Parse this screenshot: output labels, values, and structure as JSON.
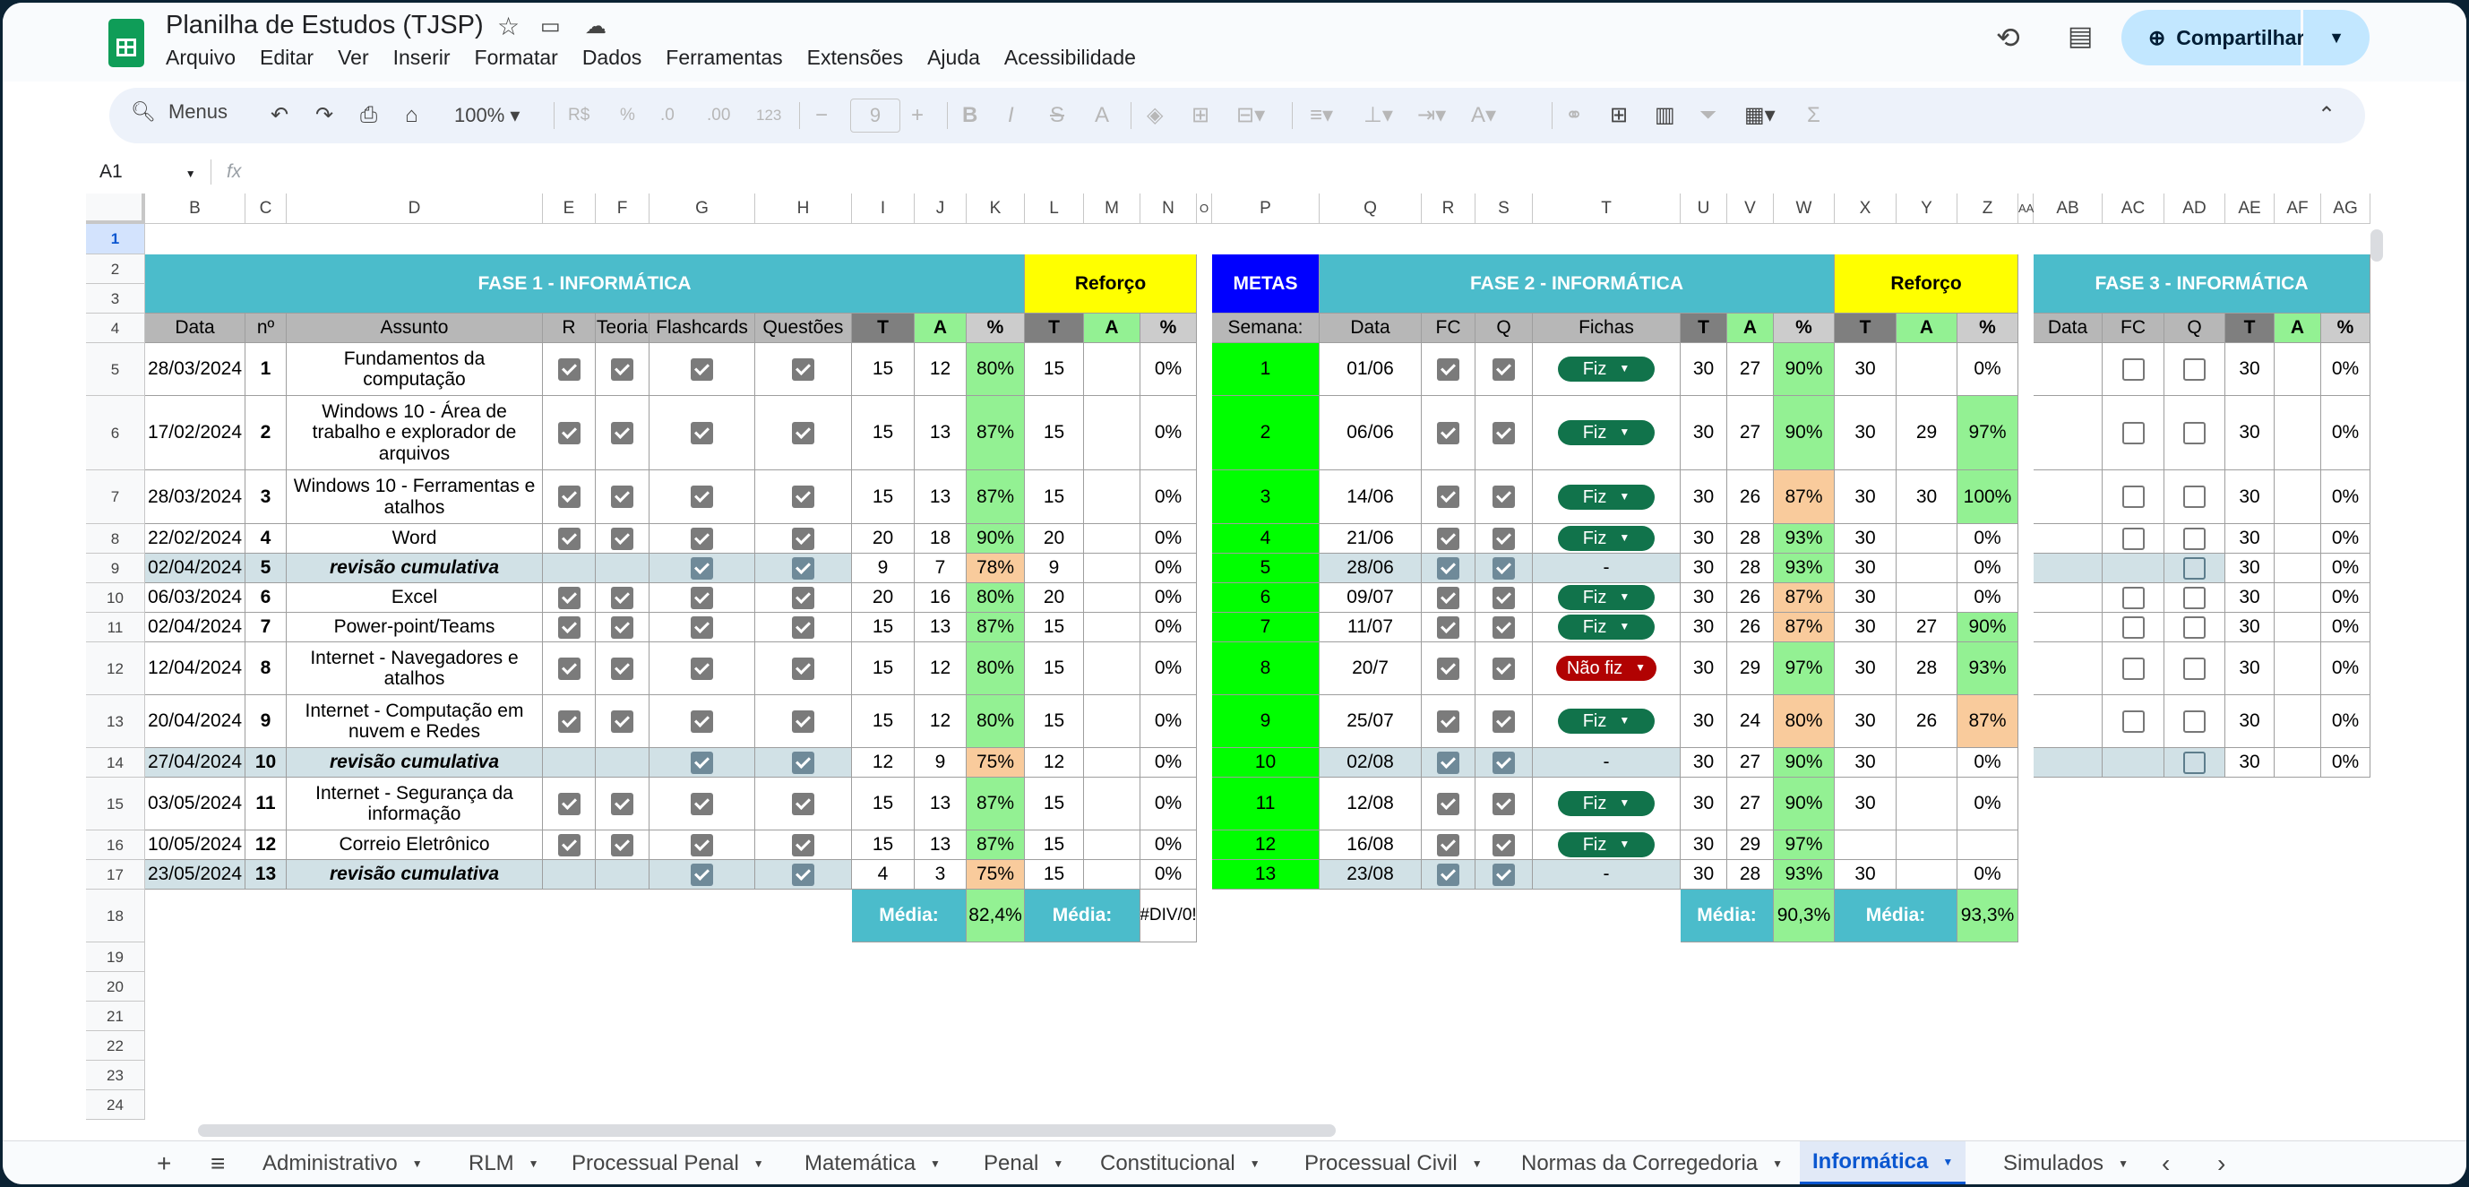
{
  "app": {
    "title": "Planilha de Estudos (TJSP)",
    "share_label": "Compartilhar",
    "menu": [
      "Arquivo",
      "Editar",
      "Ver",
      "Inserir",
      "Formatar",
      "Dados",
      "Ferramentas",
      "Extensões",
      "Ajuda",
      "Acessibilidade"
    ]
  },
  "toolbar": {
    "search": "Menus",
    "zoom": "100%",
    "font_size": "9",
    "currency": "R$",
    "percent": "%",
    "dec_down": ".0",
    "dec_up": ".00",
    "num": "123"
  },
  "formula": {
    "cell": "A1",
    "fx": "fx"
  },
  "columns": [
    "B",
    "C",
    "D",
    "E",
    "F",
    "G",
    "H",
    "I",
    "J",
    "K",
    "L",
    "M",
    "N",
    "O",
    "P",
    "Q",
    "R",
    "S",
    "T",
    "U",
    "V",
    "W",
    "X",
    "Y",
    "Z",
    "AA",
    "AB",
    "AC",
    "AD",
    "AE",
    "AF",
    "AG"
  ],
  "rows": [
    "1",
    "2",
    "3",
    "4",
    "5",
    "6",
    "7",
    "8",
    "9",
    "10",
    "11",
    "12",
    "13",
    "14",
    "15",
    "16",
    "17",
    "18",
    "19",
    "20",
    "21",
    "22",
    "23",
    "24"
  ],
  "headers": {
    "fase1": "FASE 1 - INFORMÁTICA",
    "fase2": "FASE 2 - INFORMÁTICA",
    "fase3": "FASE 3 - INFORMÁTICA",
    "reforco": "Reforço",
    "metas": "METAS"
  },
  "subheaders": {
    "data": "Data",
    "n": "nº",
    "assunto": "Assunto",
    "r": "R",
    "teoria": "Teoria",
    "flashcards": "Flashcards",
    "questoes": "Questões",
    "t": "T",
    "a": "A",
    "pct": "%",
    "semana": "Semana:",
    "fc": "FC",
    "q": "Q",
    "fichas": "Fichas"
  },
  "fase1": [
    {
      "data": "28/03/2024",
      "n": "1",
      "assunto": "Fundamentos da computação",
      "rev": false,
      "t": "15",
      "a": "12",
      "p": "80%",
      "pc": "lgreen",
      "rt": "15",
      "ra": "",
      "rp": "0%"
    },
    {
      "data": "17/02/2024",
      "n": "2",
      "assunto": "Windows 10 - Área de trabalho e explorador de arquivos",
      "rev": false,
      "t": "15",
      "a": "13",
      "p": "87%",
      "pc": "lgreen",
      "rt": "15",
      "ra": "",
      "rp": "0%"
    },
    {
      "data": "28/03/2024",
      "n": "3",
      "assunto": "Windows 10 - Ferramentas e atalhos",
      "rev": false,
      "t": "15",
      "a": "13",
      "p": "87%",
      "pc": "lgreen",
      "rt": "15",
      "ra": "",
      "rp": "0%"
    },
    {
      "data": "22/02/2024",
      "n": "4",
      "assunto": "Word",
      "rev": false,
      "t": "20",
      "a": "18",
      "p": "90%",
      "pc": "lgreen",
      "rt": "20",
      "ra": "",
      "rp": "0%"
    },
    {
      "data": "02/04/2024",
      "n": "5",
      "assunto": "revisão cumulativa",
      "rev": true,
      "t": "9",
      "a": "7",
      "p": "78%",
      "pc": "orange",
      "rt": "9",
      "ra": "",
      "rp": "0%"
    },
    {
      "data": "06/03/2024",
      "n": "6",
      "assunto": "Excel",
      "rev": false,
      "t": "20",
      "a": "16",
      "p": "80%",
      "pc": "lgreen",
      "rt": "20",
      "ra": "",
      "rp": "0%"
    },
    {
      "data": "02/04/2024",
      "n": "7",
      "assunto": "Power-point/Teams",
      "rev": false,
      "t": "15",
      "a": "13",
      "p": "87%",
      "pc": "lgreen",
      "rt": "15",
      "ra": "",
      "rp": "0%"
    },
    {
      "data": "12/04/2024",
      "n": "8",
      "assunto": "Internet - Navegadores e atalhos",
      "rev": false,
      "t": "15",
      "a": "12",
      "p": "80%",
      "pc": "lgreen",
      "rt": "15",
      "ra": "",
      "rp": "0%"
    },
    {
      "data": "20/04/2024",
      "n": "9",
      "assunto": "Internet - Computação em nuvem e Redes",
      "rev": false,
      "t": "15",
      "a": "12",
      "p": "80%",
      "pc": "lgreen",
      "rt": "15",
      "ra": "",
      "rp": "0%"
    },
    {
      "data": "27/04/2024",
      "n": "10",
      "assunto": "revisão cumulativa",
      "rev": true,
      "t": "12",
      "a": "9",
      "p": "75%",
      "pc": "orange",
      "rt": "12",
      "ra": "",
      "rp": "0%"
    },
    {
      "data": "03/05/2024",
      "n": "11",
      "assunto": "Internet - Segurança da informação",
      "rev": false,
      "t": "15",
      "a": "13",
      "p": "87%",
      "pc": "lgreen",
      "rt": "15",
      "ra": "",
      "rp": "0%"
    },
    {
      "data": "10/05/2024",
      "n": "12",
      "assunto": "Correio Eletrônico",
      "rev": false,
      "t": "15",
      "a": "13",
      "p": "87%",
      "pc": "lgreen",
      "rt": "15",
      "ra": "",
      "rp": "0%"
    },
    {
      "data": "23/05/2024",
      "n": "13",
      "assunto": "revisão cumulativa",
      "rev": true,
      "t": "4",
      "a": "3",
      "p": "75%",
      "pc": "orange",
      "rt": "15",
      "ra": "",
      "rp": "0%"
    }
  ],
  "fase2": [
    {
      "semana": "1",
      "data": "01/06",
      "ficha": "Fiz",
      "t": "30",
      "a": "27",
      "p": "90%",
      "pc": "lgreen",
      "rt": "30",
      "ra": "",
      "rp": "0%",
      "rpc": ""
    },
    {
      "semana": "2",
      "data": "06/06",
      "ficha": "Fiz",
      "t": "30",
      "a": "27",
      "p": "90%",
      "pc": "lgreen",
      "rt": "30",
      "ra": "29",
      "rp": "97%",
      "rpc": "lgreen"
    },
    {
      "semana": "3",
      "data": "14/06",
      "ficha": "Fiz",
      "t": "30",
      "a": "26",
      "p": "87%",
      "pc": "orange",
      "rt": "30",
      "ra": "30",
      "rp": "100%",
      "rpc": "lgreen"
    },
    {
      "semana": "4",
      "data": "21/06",
      "ficha": "Fiz",
      "t": "30",
      "a": "28",
      "p": "93%",
      "pc": "lgreen",
      "rt": "30",
      "ra": "",
      "rp": "0%",
      "rpc": ""
    },
    {
      "semana": "5",
      "data": "28/06",
      "ficha": "-",
      "t": "30",
      "a": "28",
      "p": "93%",
      "pc": "lgreen",
      "rt": "30",
      "ra": "",
      "rp": "0%",
      "rpc": ""
    },
    {
      "semana": "6",
      "data": "09/07",
      "ficha": "Fiz",
      "t": "30",
      "a": "26",
      "p": "87%",
      "pc": "orange",
      "rt": "30",
      "ra": "",
      "rp": "0%",
      "rpc": ""
    },
    {
      "semana": "7",
      "data": "11/07",
      "ficha": "Fiz",
      "t": "30",
      "a": "26",
      "p": "87%",
      "pc": "orange",
      "rt": "30",
      "ra": "27",
      "rp": "90%",
      "rpc": "lgreen"
    },
    {
      "semana": "8",
      "data": "20/7",
      "ficha": "Não fiz",
      "t": "30",
      "a": "29",
      "p": "97%",
      "pc": "lgreen",
      "rt": "30",
      "ra": "28",
      "rp": "93%",
      "rpc": "lgreen"
    },
    {
      "semana": "9",
      "data": "25/07",
      "ficha": "Fiz",
      "t": "30",
      "a": "24",
      "p": "80%",
      "pc": "orange",
      "rt": "30",
      "ra": "26",
      "rp": "87%",
      "rpc": "orange"
    },
    {
      "semana": "10",
      "data": "02/08",
      "ficha": "-",
      "t": "30",
      "a": "27",
      "p": "90%",
      "pc": "lgreen",
      "rt": "30",
      "ra": "",
      "rp": "0%",
      "rpc": ""
    },
    {
      "semana": "11",
      "data": "12/08",
      "ficha": "Fiz",
      "t": "30",
      "a": "27",
      "p": "90%",
      "pc": "lgreen",
      "rt": "30",
      "ra": "",
      "rp": "0%",
      "rpc": ""
    },
    {
      "semana": "12",
      "data": "16/08",
      "ficha": "Fiz",
      "t": "30",
      "a": "29",
      "p": "97%",
      "pc": "lgreen",
      "rt": "",
      "ra": "",
      "rp": "",
      "rpc": ""
    },
    {
      "semana": "13",
      "data": "23/08",
      "ficha": "-",
      "t": "30",
      "a": "28",
      "p": "93%",
      "pc": "lgreen",
      "rt": "30",
      "ra": "",
      "rp": "0%",
      "rpc": ""
    }
  ],
  "fase3": {
    "t": "30",
    "p": "0%"
  },
  "totals": {
    "media_label": "Média:",
    "f1_media": "82,4%",
    "f1_ref": "#DIV/0!",
    "f2_media": "90,3%",
    "f2_ref": "93,3%"
  },
  "tabs": [
    "Administrativo",
    "RLM",
    "Processual Penal",
    "Matemática",
    "Penal",
    "Constitucional",
    "Processual Civil",
    "Normas da Corregedoria",
    "Informática",
    "Simulados"
  ],
  "active_tab": "Informática",
  "colors": {
    "teal": "#4bbccb",
    "yellow": "#ffff00",
    "metas_blue": "#0000ff",
    "green": "#00ff00",
    "light_green": "#93f193",
    "orange": "#f9cb9c",
    "review": "#d1e1e6"
  }
}
